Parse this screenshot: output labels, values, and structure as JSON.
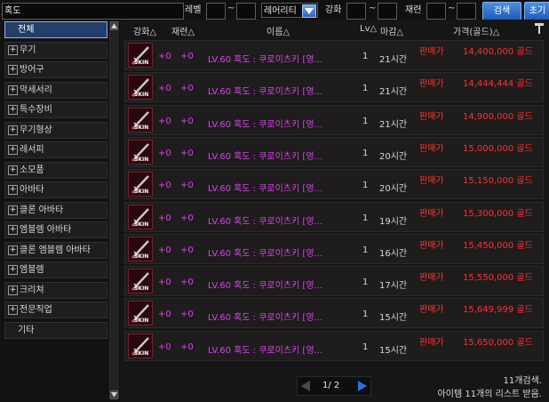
{
  "topbar": {
    "search_value": "혹도",
    "level_label": "레벨",
    "rarity_value": "레어리티",
    "enhance_label": "강화",
    "refine_label": "재련",
    "tilde": "~",
    "search_button": "검색",
    "reset_button": "초기"
  },
  "categories": [
    {
      "label": "전체",
      "selected": true
    },
    {
      "label": "무기"
    },
    {
      "label": "방어구"
    },
    {
      "label": "악세서리"
    },
    {
      "label": "특수장비"
    },
    {
      "label": "무기형상"
    },
    {
      "label": "레서피"
    },
    {
      "label": "소모품"
    },
    {
      "label": "아바타"
    },
    {
      "label": "클론 아바타"
    },
    {
      "label": "엠블렘 아바타"
    },
    {
      "label": "클론 엠블렘 아바타"
    },
    {
      "label": "엠블렘"
    },
    {
      "label": "크리쳐"
    },
    {
      "label": "전문직업"
    },
    {
      "label": "기타"
    }
  ],
  "columns": {
    "enhance": "강화△",
    "refine": "재련△",
    "name": "이름△",
    "level": "Lv△",
    "deadline": "마감△",
    "price": "가격(골드)△"
  },
  "icons": {
    "item": "katana-skin-icon",
    "hammer": "hammer-icon",
    "prev": "triangle-left-icon",
    "next": "triangle-right-icon"
  },
  "skin_label": "SKIN",
  "rows": [
    {
      "enhance": "+0",
      "refine": "+0",
      "name": "LV.60 혹도 : 쿠로이츠키 [영...",
      "count": "1",
      "time": "21시간",
      "seller": "판매가",
      "price": "14,400,000 골드"
    },
    {
      "enhance": "+0",
      "refine": "+0",
      "name": "LV.60 혹도 : 쿠로이츠키 [영...",
      "count": "1",
      "time": "21시간",
      "seller": "판매가",
      "price": "14,444,444 골드"
    },
    {
      "enhance": "+0",
      "refine": "+0",
      "name": "LV.60 혹도 : 쿠로이츠키 [영...",
      "count": "1",
      "time": "21시간",
      "seller": "판매가",
      "price": "14,900,000 골드"
    },
    {
      "enhance": "+0",
      "refine": "+0",
      "name": "LV.60 혹도 : 쿠로이츠키 [영...",
      "count": "1",
      "time": "20시간",
      "seller": "판매가",
      "price": "15,000,000 골드"
    },
    {
      "enhance": "+0",
      "refine": "+0",
      "name": "LV.60 혹도 : 쿠로이츠키 [영...",
      "count": "1",
      "time": "20시간",
      "seller": "판매가",
      "price": "15,150,000 골드"
    },
    {
      "enhance": "+0",
      "refine": "+0",
      "name": "LV.60 혹도 : 쿠로이츠키 [영...",
      "count": "1",
      "time": "19시간",
      "seller": "판매가",
      "price": "15,300,000 골드"
    },
    {
      "enhance": "+0",
      "refine": "+0",
      "name": "LV.60 혹도 : 쿠로이츠키 [영...",
      "count": "1",
      "time": "16시간",
      "seller": "판매가",
      "price": "15,450,000 골드"
    },
    {
      "enhance": "+0",
      "refine": "+0",
      "name": "LV.60 혹도 : 쿠로이츠키 [영...",
      "count": "1",
      "time": "17시간",
      "seller": "판매가",
      "price": "15,550,000 골드"
    },
    {
      "enhance": "+0",
      "refine": "+0",
      "name": "LV.60 혹도 : 쿠로이츠키 [영...",
      "count": "1",
      "time": "15시간",
      "seller": "판매가",
      "price": "15,649,999 골드"
    },
    {
      "enhance": "+0",
      "refine": "+0",
      "name": "LV.60 혹도 : 쿠로이츠키 [영...",
      "count": "1",
      "time": "15시간",
      "seller": "판매가",
      "price": "15,650,000 골드"
    }
  ],
  "pager": {
    "text": "1/ 2"
  },
  "results": {
    "count_text": "11개검색.",
    "list_text": "아이템 11개의 리스트 받음."
  },
  "colors": {
    "accent_blue": "#2a63c0",
    "price_red": "#ff3030",
    "enhance_magenta": "#d445e8"
  }
}
